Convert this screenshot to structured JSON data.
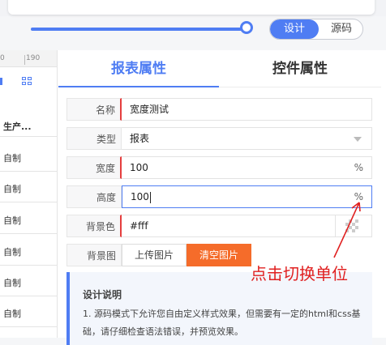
{
  "toolbar": {
    "mode_design": "设计",
    "mode_source": "源码",
    "zoom_level": 1.0
  },
  "ruler": {
    "tick_left": "0",
    "tick_right": "190"
  },
  "left_list": {
    "header": "生产...",
    "rows": [
      "自制",
      "自制",
      "自制",
      "自制",
      "自制",
      "自制"
    ]
  },
  "tabs": {
    "report_props": "报表属性",
    "widget_props": "控件属性"
  },
  "form": {
    "name_label": "名称",
    "name_value": "宽度测试",
    "type_label": "类型",
    "type_value": "报表",
    "width_label": "宽度",
    "width_value": "100",
    "width_unit": "%",
    "height_label": "高度",
    "height_value": "100",
    "height_unit": "%",
    "bgcolor_label": "背景色",
    "bgcolor_value": "#fff",
    "bgimage_label": "背景图",
    "upload_button": "上传图片",
    "clear_button": "清空图片"
  },
  "note": {
    "title": "设计说明",
    "text": "1. 源码模式下允许您自由定义样式效果，但需要有一定的html和css基础，请仔细检查语法错误，并预览效果。"
  },
  "annotation": {
    "text": "点击切换单位"
  },
  "colors": {
    "accent": "#4f7df3",
    "danger": "#f56c2a",
    "annotation": "#e02020"
  }
}
